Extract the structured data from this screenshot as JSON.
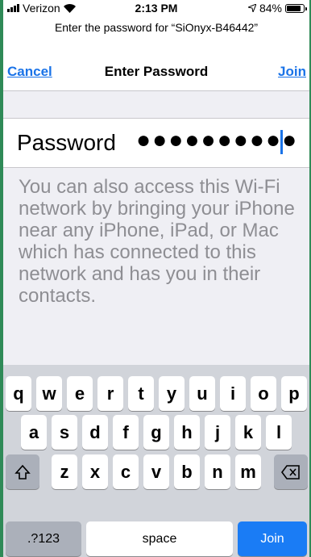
{
  "status_bar": {
    "carrier": "Verizon",
    "time": "2:13 PM",
    "battery": "84%",
    "battery_level": 0.84
  },
  "prompt": "Enter the password for “SiOnyx-B46442”",
  "nav": {
    "cancel": "Cancel",
    "title": "Enter Password",
    "join": "Join"
  },
  "password": {
    "label": "Password",
    "masked_value": "●●●●●●●●●●"
  },
  "info_text": "You can also access this Wi-Fi network by bringing your iPhone near any iPhone, iPad, or Mac which has connected to this network and has you in their contacts.",
  "keyboard": {
    "row1": [
      "q",
      "w",
      "e",
      "r",
      "t",
      "y",
      "u",
      "i",
      "o",
      "p"
    ],
    "row2": [
      "a",
      "s",
      "d",
      "f",
      "g",
      "h",
      "j",
      "k",
      "l"
    ],
    "row3": [
      "z",
      "x",
      "c",
      "v",
      "b",
      "n",
      "m"
    ],
    "numbers_key": ".?123",
    "space_key": "space",
    "join_key": "Join",
    "shift_icon": "shift-icon",
    "delete_icon": "delete-icon"
  }
}
